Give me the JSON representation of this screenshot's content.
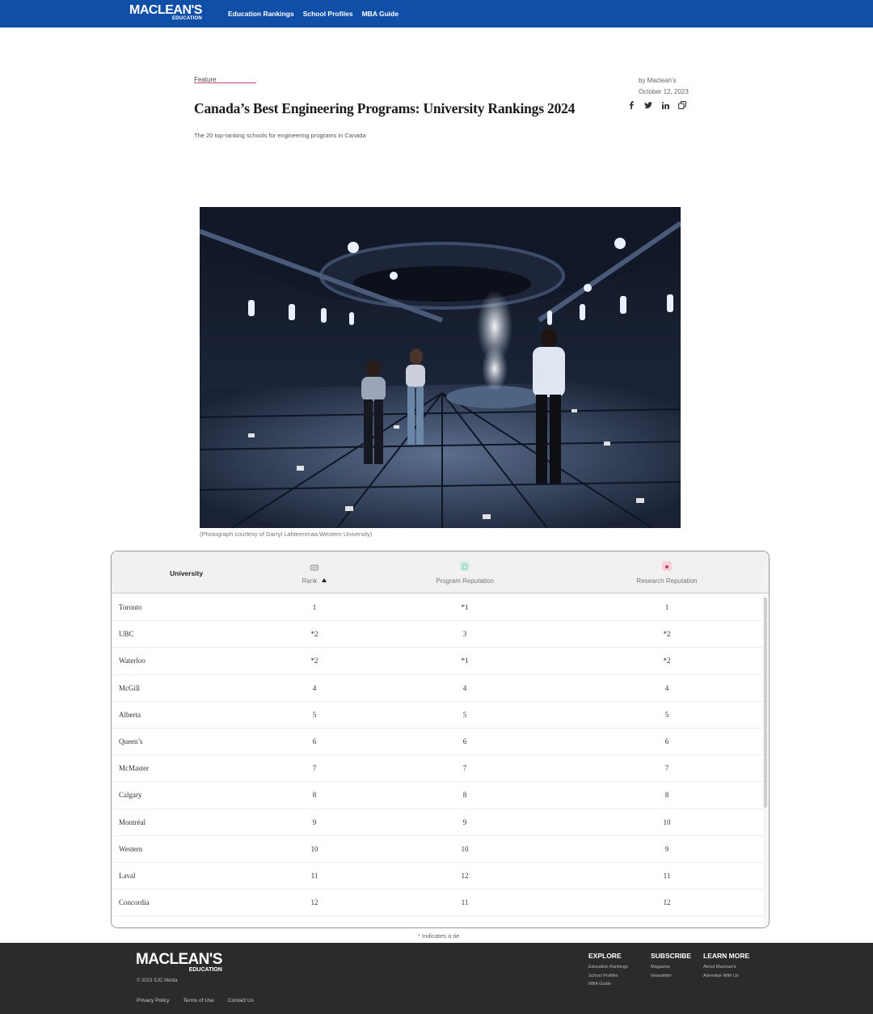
{
  "header": {
    "logo_main": "MACLEAN'S",
    "logo_sub": "EDUCATION",
    "nav": [
      "Education Rankings",
      "School Profiles",
      "MBA Guide"
    ]
  },
  "article": {
    "kicker": "Feature",
    "author": "by Maclean's",
    "date": "October 12, 2023",
    "title": "Canada’s Best Engineering Programs: University Rankings 2024",
    "dek": "The 20 top-ranking schools for engineering programs in Canada",
    "photo_caption": "(Photograph courtesy of Darryl Lahteenmaa:Western University)",
    "social_icons": [
      "facebook-icon",
      "twitter-icon",
      "linkedin-icon",
      "copy-link-icon"
    ]
  },
  "table": {
    "headers": {
      "university": "University",
      "rank": "Rank",
      "program": "Program Reputation",
      "research": "Research Reputation"
    },
    "rows": [
      {
        "university": "Toronto",
        "rank": "1",
        "program": "*1",
        "research": "1"
      },
      {
        "university": "UBC",
        "rank": "*2",
        "program": "3",
        "research": "*2"
      },
      {
        "university": "Waterloo",
        "rank": "*2",
        "program": "*1",
        "research": "*2"
      },
      {
        "university": "McGill",
        "rank": "4",
        "program": "4",
        "research": "4"
      },
      {
        "university": "Alberta",
        "rank": "5",
        "program": "5",
        "research": "5"
      },
      {
        "university": "Queen’s",
        "rank": "6",
        "program": "6",
        "research": "6"
      },
      {
        "university": "McMaster",
        "rank": "7",
        "program": "7",
        "research": "7"
      },
      {
        "university": "Calgary",
        "rank": "8",
        "program": "8",
        "research": "8"
      },
      {
        "university": "Montréal",
        "rank": "9",
        "program": "9",
        "research": "10"
      },
      {
        "university": "Western",
        "rank": "10",
        "program": "10",
        "research": "9"
      },
      {
        "university": "Laval",
        "rank": "11",
        "program": "12",
        "research": "11"
      },
      {
        "university": "Concordia",
        "rank": "12",
        "program": "11",
        "research": "12"
      }
    ],
    "tie_note": "* Indicates a tie",
    "colors": {
      "rank_icon": "#e4e4e4",
      "program_icon": "#cfeee6",
      "research_icon": "#f6cfd8"
    }
  },
  "footer": {
    "logo_main": "MACLEAN'S",
    "logo_sub": "EDUCATION",
    "copyright": "© 2023 SJC Media",
    "links": [
      "Privacy Policy",
      "Terms of Use",
      "Contact Us"
    ],
    "explore": {
      "title": "EXPLORE",
      "items": [
        "Education Rankings",
        "School Profiles",
        "MBA Guide"
      ]
    },
    "subscribe": {
      "title": "SUBSCRIBE",
      "items": [
        "Magazine",
        "Newsletter"
      ]
    },
    "learn": {
      "title": "LEARN MORE",
      "items": [
        "About Maclean's",
        "Advertise With Us"
      ]
    }
  },
  "colors": {
    "header_bg": "#0f4fa8",
    "footer_bg": "#2b2b2b",
    "kicker_accent": "#c1536d"
  }
}
